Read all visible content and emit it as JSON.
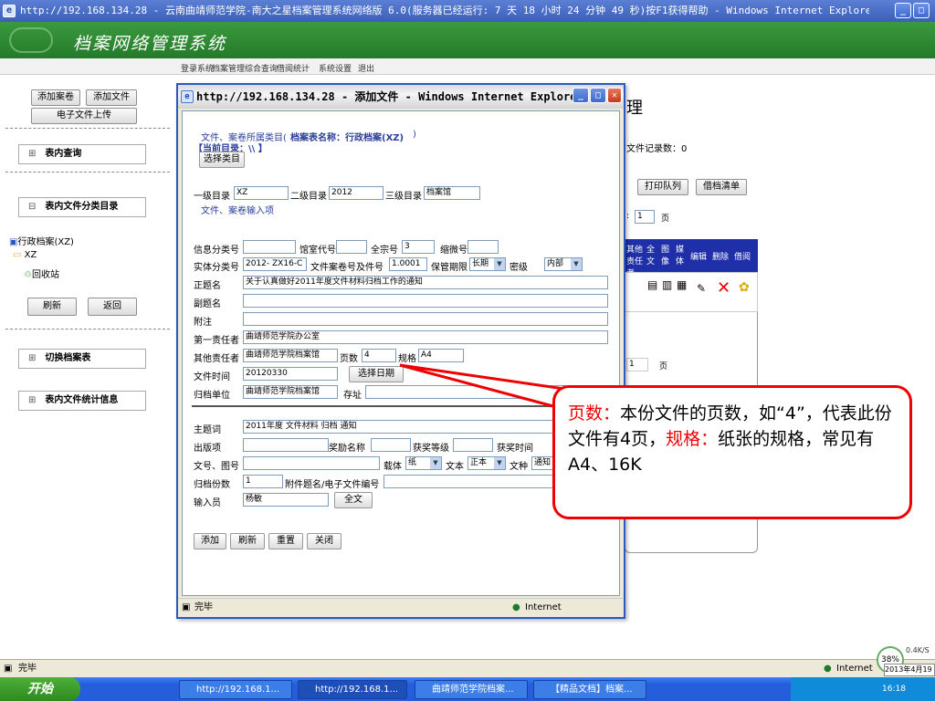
{
  "outer_window": {
    "title": "http://192.168.134.28 - 云南曲靖师范学院-南大之星档案管理系统网络版 6.0(服务器已经运行: 7 天 18 小时 24 分钟 49 秒)按F1获得帮助 - Windows Internet Explorer"
  },
  "banner": {
    "system_name": "档案网络管理系统"
  },
  "top_menu": [
    "登录系统",
    "档案管理",
    "综合查询",
    "借阅统计",
    "系统设置",
    "退出"
  ],
  "left": {
    "add_record": "添加案卷",
    "add_file": "添加文件",
    "upload": "电子文件上传",
    "table_query": "表内查询",
    "category_tree": "表内文件分类目录",
    "tree_root": "行政档案(XZ)",
    "tree_xz": "XZ",
    "tree_recycle": "回收站",
    "refresh": "刷新",
    "back": "返回",
    "switch_table": "切换档案表",
    "stats": "表内文件统计信息"
  },
  "main_behind": {
    "heading_fragment": "理",
    "record_count": "文件记录数：0",
    "print_queue": "打印队列",
    "borrow_list": "借档清单",
    "page_prefix": ":",
    "page_value": "1",
    "page_suffix": "页",
    "col_other": "其他责任者",
    "col_full": "全文",
    "col_image": "图像",
    "col_media": "媒体",
    "col_edit": "编辑",
    "col_delete": "删除",
    "col_borrow": "借阅",
    "page2_value": "1",
    "page2_suffix": "页"
  },
  "dialog": {
    "title": "http://192.168.134.28 - 添加文件 - Windows Internet Explorer",
    "category_label": "文件、案卷所属类目(",
    "category_table": "档案表名称：行政档案(XZ)",
    "category_close": ")",
    "current_dir": "【当前目录：\\\\ 】",
    "choose_category": "选择类目",
    "level1_label": "一级目录",
    "level1_value": "XZ",
    "level2_label": "二级目录",
    "level2_value": "2012",
    "level3_label": "三级目录",
    "level3_value": "档案馆",
    "input_section": "文件、案卷输入项",
    "info_cls_label": "信息分类号",
    "hall_code_label": "馆室代号",
    "fonds_label": "全宗号",
    "fonds_value": "3",
    "microfilm_label": "缩微号",
    "entity_cls_label": "实体分类号",
    "entity_cls_value": "2012- ZX16-C",
    "file_no_label": "文件案卷号及件号",
    "file_no_value": "1.0001",
    "retention_label": "保管期限",
    "retention_value": "长期",
    "security_label": "密级",
    "security_value": "内部",
    "title_label": "正题名",
    "title_value": "关于认真做好2011年度文件材料归档工作的通知",
    "subtitle_label": "副题名",
    "note_label": "附注",
    "first_resp_label": "第一责任者",
    "first_resp_value": "曲靖师范学院办公室",
    "other_resp_label": "其他责任者",
    "other_resp_value": "曲靖师范学院档案馆",
    "pages_label": "页数",
    "pages_value": "4",
    "spec_label": "规格",
    "spec_value": "A4",
    "date_label": "文件时间",
    "date_value": "20120330",
    "choose_date": "选择日期",
    "archive_unit_label": "归档单位",
    "archive_unit_value": "曲靖师范学院档案馆",
    "location_label": "存址",
    "subject_label": "主题词",
    "subject_value": "2011年度 文件材料 归档 通知",
    "publish_label": "出版项",
    "award_label": "奖励名称",
    "award_level_label": "获奖等级",
    "award_time_label": "获奖时间",
    "doc_no_label": "文号、图号",
    "carrier_label": "载体",
    "carrier_value": "纸",
    "text_label": "文本",
    "text_value": "正本",
    "doc_type_label": "文种",
    "doc_type_value": "通知",
    "copies_label": "归档份数",
    "copies_value": "1",
    "attach_label": "附件题名/电子文件编号",
    "inputter_label": "输入员",
    "inputter_value": "杨敏",
    "fulltext_btn": "全文",
    "add_btn": "添加",
    "refresh_btn": "刷新",
    "reset_btn": "重置",
    "close_btn": "关闭",
    "status_done": "完毕",
    "status_zone": "Internet"
  },
  "callout": {
    "pages_term": "页数：",
    "pages_desc": "本份文件的页数，如“4”，代表此份文件有4页，",
    "spec_term": "规格：",
    "spec_desc": "纸张的规格，常见有A4、16K"
  },
  "statusbar": {
    "done": "完毕",
    "zone": "Internet"
  },
  "taskbar": {
    "start": "开始",
    "tasks": [
      "http://192.168.1...",
      "http://192.168.1...",
      "曲靖师范学院档案...",
      "【精品文档】档案..."
    ],
    "percent": "38%",
    "speed": "0.4K/S",
    "date": "2013年4月19",
    "time": "16:18"
  }
}
